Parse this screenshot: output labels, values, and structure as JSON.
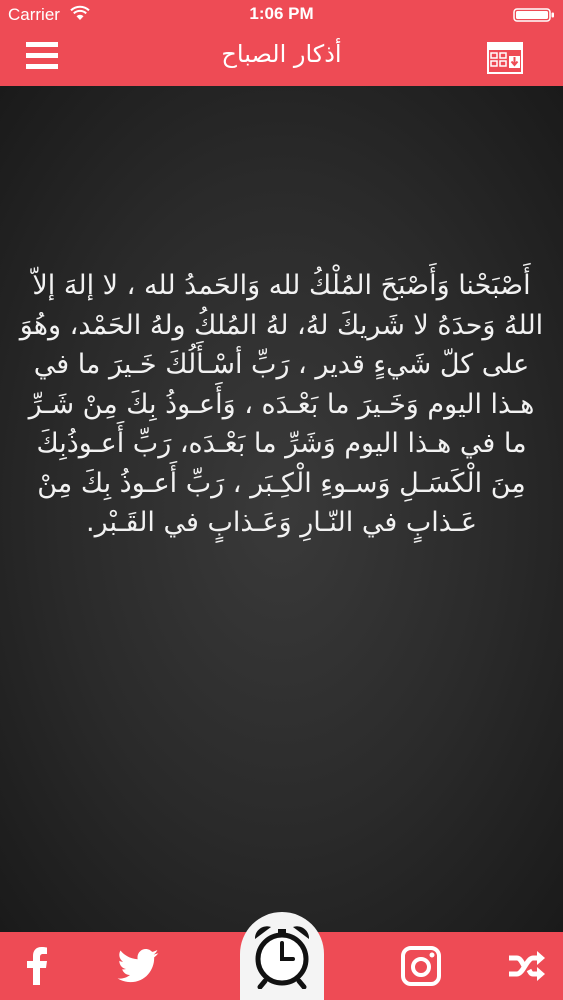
{
  "status_bar": {
    "carrier": "Carrier",
    "time": "1:06 PM"
  },
  "header": {
    "title": "أذكار الصباح",
    "menu_icon": "menu-icon",
    "calendar_icon": "calendar-download-icon"
  },
  "content": {
    "text": "أَصْبَحْنا وَأَصْبَحَ المُلْكُ لله وَالحَمدُ لله ، لا إلهَ إلاّ اللهُ وَحدَهُ لا شَريكَ لهُ، لهُ المُلكُ ولهُ الحَمْد، وهُوَ على كلّ شَيءٍ قدير ، رَبِّ أسْـأَلُكَ خَـيرَ ما في هـذا اليوم وَخَـيرَ ما بَعْـدَه ، وَأَعـوذُ بِكَ مِنْ شَـرِّ ما في هـذا اليوم وَشَرِّ ما بَعْـدَه، رَبِّ أَعـوذُبِكَ مِنَ الْكَسَـلِ وَسـوءِ الْكِـبَر ، رَبِّ أَعـوذُ بِكَ مِنْ عَـذابٍ في النّـارِ وَعَـذابٍ في القَـبْر."
  },
  "tab_bar": {
    "items": [
      {
        "icon": "facebook-icon"
      },
      {
        "icon": "twitter-icon"
      },
      {
        "icon": "alarm-clock-icon"
      },
      {
        "icon": "instagram-icon"
      },
      {
        "icon": "shuffle-icon"
      }
    ]
  },
  "colors": {
    "accent": "#ee4b55",
    "board": "#2a2a2a",
    "text": "#f2f2f2"
  }
}
